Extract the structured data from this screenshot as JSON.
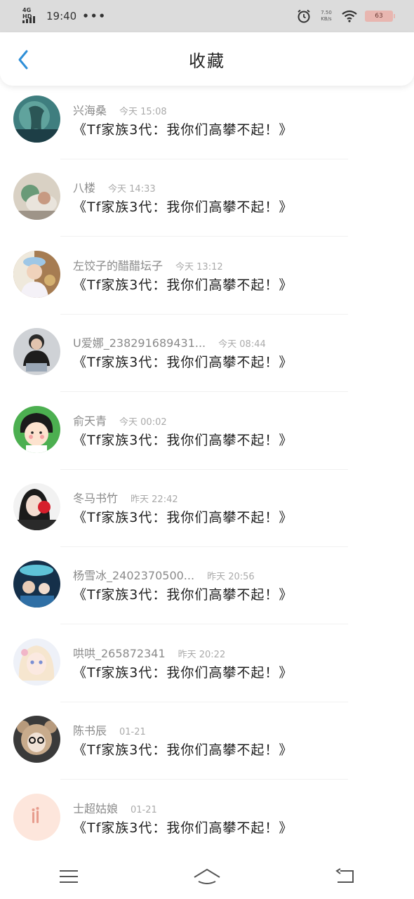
{
  "status_bar": {
    "network": "4G HD",
    "time": "19:40",
    "dots": "•••",
    "speed": "7.50 KB/s",
    "battery": "63"
  },
  "header": {
    "title": "收藏",
    "back_icon": "chevron-left-icon",
    "accent": "#2f8fd8"
  },
  "items": [
    {
      "name": "兴海桑",
      "time": "今天 15:08",
      "title": "《Tf家族3代：我你们高攀不起！》",
      "avatar": "avatar-teal"
    },
    {
      "name": "八楼",
      "time": "今天 14:33",
      "title": "《Tf家族3代：我你们高攀不起！》",
      "avatar": "avatar-green"
    },
    {
      "name": "左饺子的醋醋坛子",
      "time": "今天 13:12",
      "title": "《Tf家族3代：我你们高攀不起！》",
      "avatar": "avatar-cap"
    },
    {
      "name": "U爱娜_238291689431...",
      "time": "今天 08:44",
      "title": "《Tf家族3代：我你们高攀不起！》",
      "avatar": "avatar-dark"
    },
    {
      "name": "俞天青",
      "time": "今天 00:02",
      "title": "《Tf家族3代：我你们高攀不起！》",
      "avatar": "avatar-cartoon"
    },
    {
      "name": "冬马书竹",
      "time": "昨天 22:42",
      "title": "《Tf家族3代：我你们高攀不起！》",
      "avatar": "avatar-red"
    },
    {
      "name": "杨雪冰_2402370500...",
      "time": "昨天 20:56",
      "title": "《Tf家族3代：我你们高攀不起！》",
      "avatar": "avatar-blue"
    },
    {
      "name": "哄哄_265872341",
      "time": "昨天 20:22",
      "title": "《Tf家族3代：我你们高攀不起！》",
      "avatar": "avatar-anime"
    },
    {
      "name": "陈书辰",
      "time": "01-21",
      "title": "《Tf家族3代：我你们高攀不起！》",
      "avatar": "avatar-bear"
    },
    {
      "name": "士超姑娘",
      "time": "01-21",
      "title": "《Tf家族3代：我你们高攀不起！》",
      "avatar": "avatar-pink"
    }
  ],
  "nav_bar": {
    "menu_icon": "menu-icon",
    "home_icon": "home-icon",
    "back_icon": "back-icon"
  }
}
